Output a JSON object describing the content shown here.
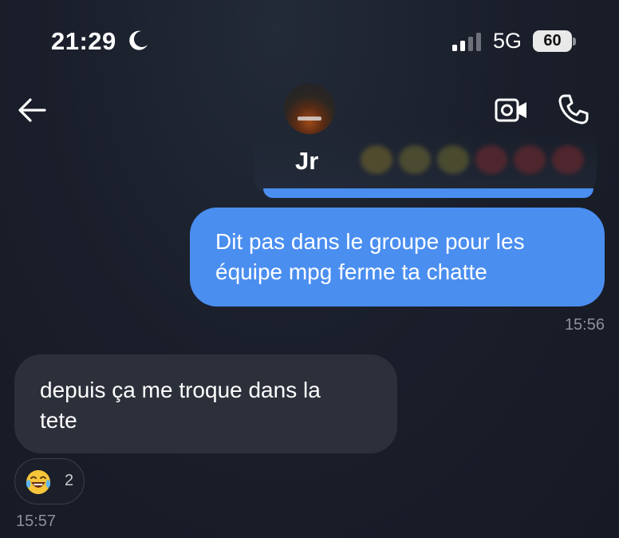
{
  "status_bar": {
    "time": "21:29",
    "moon_icon": "moon-icon",
    "signal_icon": "signal-bars-icon",
    "network": "5G",
    "battery": "60"
  },
  "header": {
    "back_icon": "arrow-left-icon",
    "contact_name": "Jr",
    "video_icon": "video-camera-icon",
    "phone_icon": "phone-icon"
  },
  "messages": [
    {
      "direction": "outgoing",
      "lines": [
        "Dit pas dans le groupe pour les",
        "équipe mpg ferme ta chatte"
      ],
      "time": "15:56"
    },
    {
      "direction": "incoming",
      "lines": [
        "depuis ça me troque dans la",
        "tete"
      ],
      "reaction": {
        "emoji_icon": "tears-of-joy-emoji-icon",
        "count": "2"
      },
      "time": "15:57"
    }
  ],
  "colors": {
    "background": "#171b25",
    "outgoing_bubble": "#4a8ef0",
    "incoming_bubble": "#2c303a",
    "timestamp": "#8b909b"
  }
}
